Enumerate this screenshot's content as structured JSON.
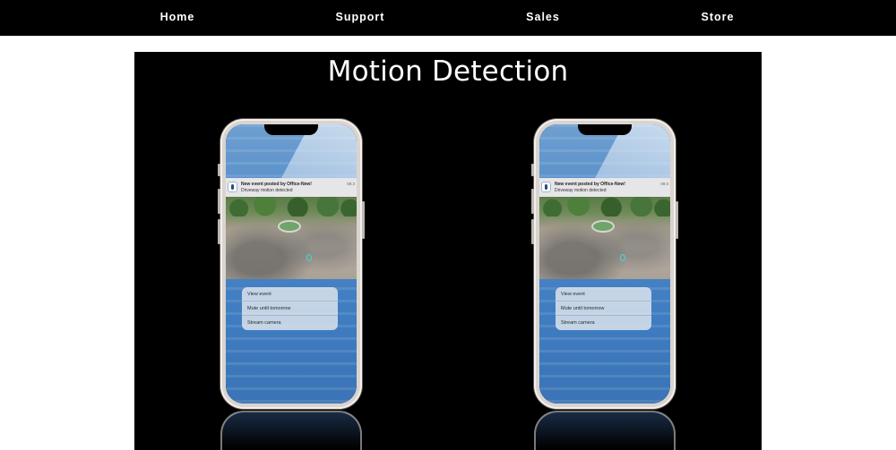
{
  "nav": {
    "items": [
      {
        "label": "Home"
      },
      {
        "label": "Support"
      },
      {
        "label": "Sales"
      },
      {
        "label": "Store"
      }
    ]
  },
  "section": {
    "title": "Motion Detection"
  },
  "phones": [
    {
      "notification": {
        "title": "New event posted by Office-New!",
        "body": "Driveway motion detected",
        "time": "09:3"
      },
      "menu": [
        "View event",
        "Mute until tomorrow",
        "Stream camera"
      ]
    },
    {
      "notification": {
        "title": "New event posted by Office-New!",
        "body": "Driveway motion detected",
        "time": "09:3"
      },
      "menu": [
        "View event",
        "Mute until tomorrow",
        "Stream camera"
      ]
    }
  ],
  "colors": {
    "nav_bg": "#000000",
    "stage_bg": "#000000",
    "text_light": "#ffffff",
    "motion_highlight": "#43d7df"
  }
}
